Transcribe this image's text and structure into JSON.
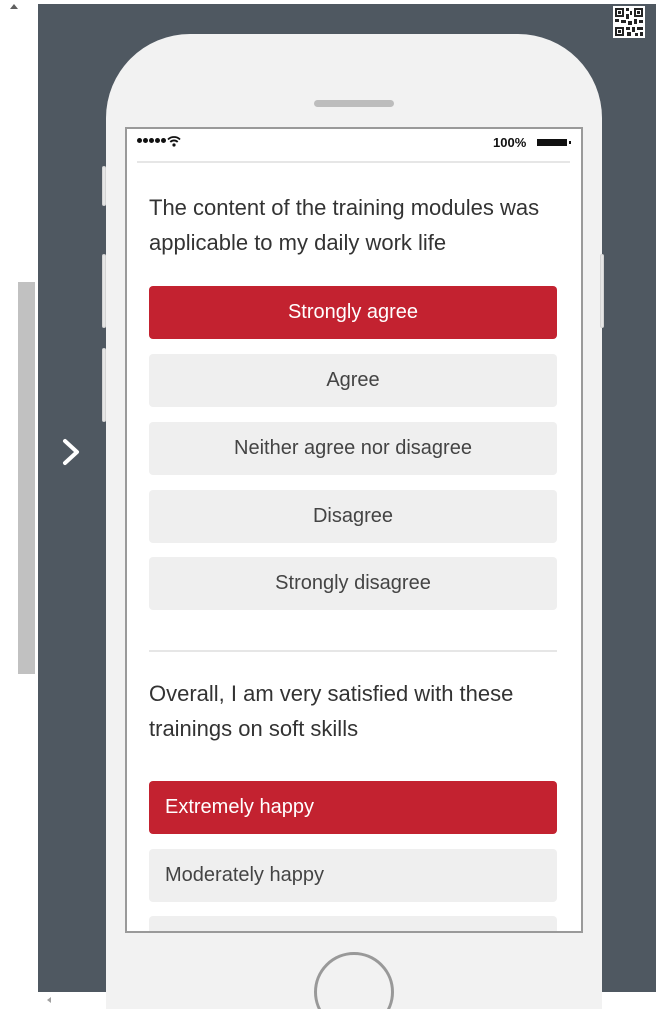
{
  "status_bar": {
    "battery_label": "100%"
  },
  "question_1": {
    "text": "The content of the training modules was applicable to my daily work life",
    "options": [
      {
        "label": "Strongly agree",
        "selected": true
      },
      {
        "label": "Agree",
        "selected": false
      },
      {
        "label": "Neither agree nor disagree",
        "selected": false
      },
      {
        "label": "Disagree",
        "selected": false
      },
      {
        "label": "Strongly disagree",
        "selected": false
      }
    ]
  },
  "question_2": {
    "text": "Overall, I am very satisfied with these trainings on soft skills",
    "options": [
      {
        "label": "Extremely happy",
        "selected": true
      },
      {
        "label": "Moderately happy",
        "selected": false
      },
      {
        "label": "",
        "selected": false
      }
    ]
  },
  "colors": {
    "accent": "#c32230",
    "stage_background": "#4f5861",
    "option_background": "#efefef"
  },
  "icons": {
    "navigation": "chevron-right-icon",
    "corner": "qr-code-icon",
    "status": [
      "signal-icon",
      "wifi-icon",
      "battery-icon"
    ]
  }
}
